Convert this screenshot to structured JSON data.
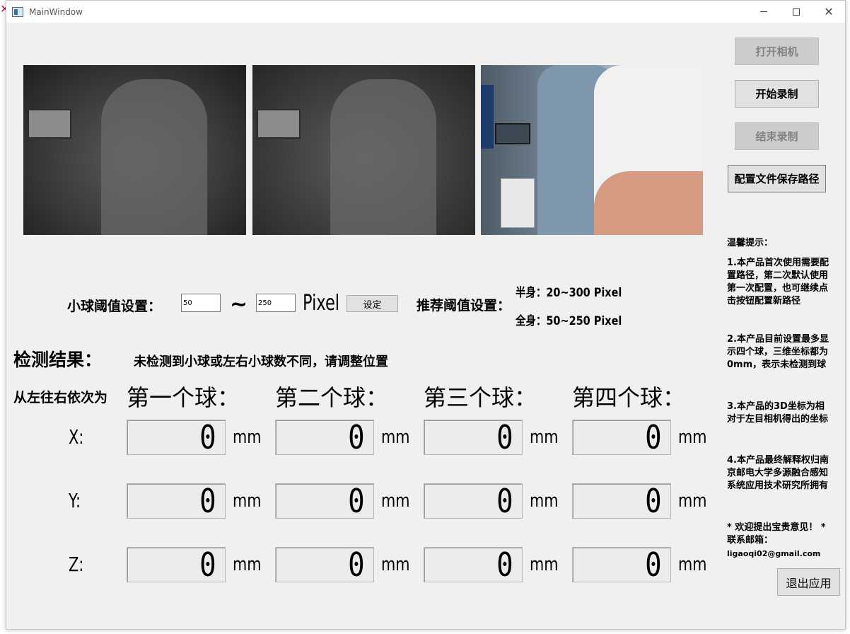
{
  "window": {
    "title": "MainWindow"
  },
  "buttons": {
    "open_camera": "打开相机",
    "start_record": "开始录制",
    "stop_record": "结束录制",
    "config_path": "配置文件保存路径",
    "set": "设定",
    "exit": "退出应用"
  },
  "threshold": {
    "label": "小球阈值设置：",
    "min_value": "50",
    "max_value": "250",
    "tilde": "~",
    "unit": "Pixel",
    "recommend_label": "推荐阈值设置：",
    "half_body": "半身：20~300 Pixel",
    "full_body": "全身：50~250 Pixel"
  },
  "result": {
    "label": "检测结果：",
    "status": "未检测到小球或左右小球数不同，请调整位置",
    "order_label": "从左往右依次为"
  },
  "balls": [
    {
      "name": "第一个球：",
      "x": "0",
      "y": "0",
      "z": "0"
    },
    {
      "name": "第二个球：",
      "x": "0",
      "y": "0",
      "z": "0"
    },
    {
      "name": "第三个球：",
      "x": "0",
      "y": "0",
      "z": "0"
    },
    {
      "name": "第四个球：",
      "x": "0",
      "y": "0",
      "z": "0"
    }
  ],
  "axes": {
    "x": "X:",
    "y": "Y:",
    "z": "Z:"
  },
  "unit_mm": "mm",
  "tips": {
    "title": "温馨提示：",
    "t1": "1.本产品首次使用需要配置路径，第二次默认使用第一次配置，也可继续点击按钮配置新路径",
    "t2": "2.本产品目前设置最多显示四个球，三维坐标都为0mm，表示未检测到球",
    "t3": "3.本产品的3D坐标为相对于左目相机得出的坐标",
    "t4": "4.本产品最终解释权归南京邮电大学多源融合感知系统应用技术研究所拥有",
    "t5": "* 欢迎提出宝贵意见！ * 联系邮箱：",
    "email": "ligaoqi02@gmail.com"
  },
  "colors": {
    "window_bg": "#f0f0f0",
    "button_bg": "#e1e1e1",
    "disabled_text": "#838383"
  }
}
